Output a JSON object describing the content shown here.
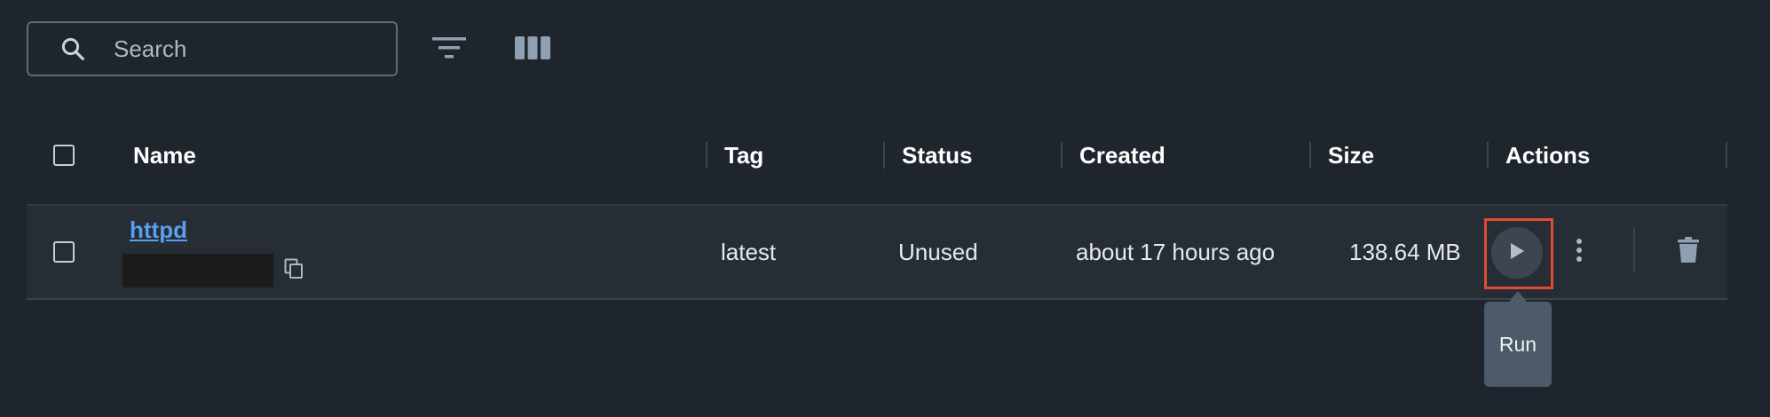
{
  "search": {
    "placeholder": "Search",
    "value": ""
  },
  "toolbar": {
    "filter_icon": "filter-icon",
    "columns_icon": "columns-icon"
  },
  "table": {
    "columns": [
      "Name",
      "Tag",
      "Status",
      "Created",
      "Size",
      "Actions"
    ],
    "rows": [
      {
        "name": "httpd",
        "tag": "latest",
        "status": "Unused",
        "created": "about 17 hours ago",
        "size": "138.64 MB"
      }
    ]
  },
  "tooltip": {
    "text": "Run"
  },
  "colors": {
    "link": "#5a9ef0",
    "highlight": "#e24a36",
    "background": "#1f252d"
  }
}
